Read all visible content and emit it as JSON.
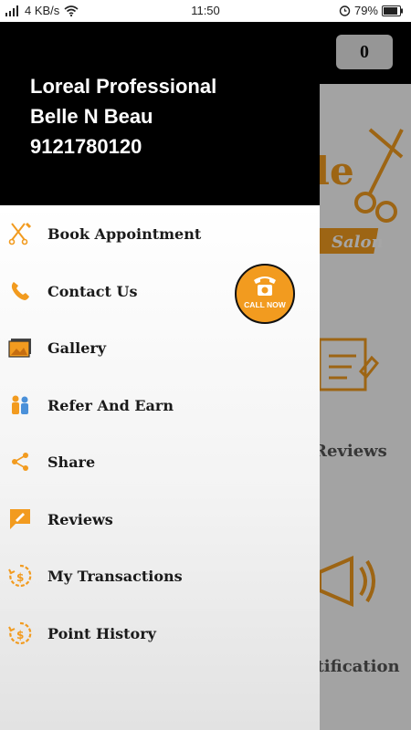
{
  "status_bar": {
    "speed": "4 KB/s",
    "time": "11:50",
    "battery": "79%"
  },
  "app": {
    "cart_count": "0",
    "bg_reviews": "Reviews",
    "bg_notification": "Notification",
    "logo_text_salon": "Salon"
  },
  "drawer": {
    "header": {
      "line1": "Loreal Professional",
      "line2": "Belle N Beau",
      "line3": "9121780120"
    },
    "items": [
      {
        "label": "Book Appointment",
        "icon": "scissors-comb-icon"
      },
      {
        "label": "Contact Us",
        "icon": "phone-icon"
      },
      {
        "label": "Gallery",
        "icon": "gallery-icon"
      },
      {
        "label": "Refer And Earn",
        "icon": "refer-icon"
      },
      {
        "label": "Share",
        "icon": "share-icon"
      },
      {
        "label": "Reviews",
        "icon": "reviews-icon"
      },
      {
        "label": "My Transactions",
        "icon": "dollar-history-icon"
      },
      {
        "label": "Point History",
        "icon": "dollar-history-icon"
      }
    ]
  },
  "call_now": {
    "label": "CALL NOW"
  },
  "colors": {
    "accent": "#f29b1f",
    "header_bg": "#000000"
  }
}
